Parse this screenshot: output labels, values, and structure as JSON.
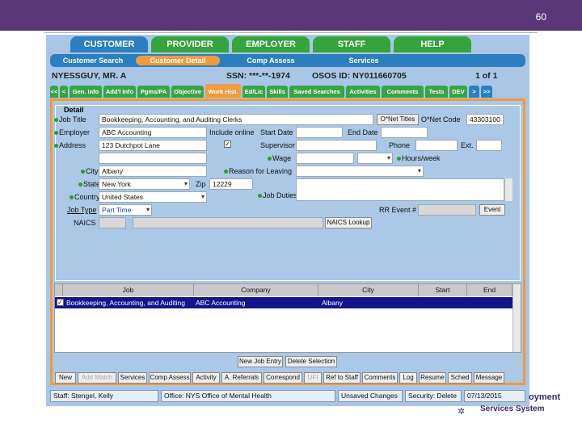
{
  "slide": {
    "number": "60"
  },
  "main_tabs": [
    {
      "label": "CUSTOMER",
      "active": true
    },
    {
      "label": "PROVIDER",
      "active": false
    },
    {
      "label": "EMPLOYER",
      "active": false
    },
    {
      "label": "STAFF",
      "active": false
    },
    {
      "label": "HELP",
      "active": false
    }
  ],
  "sub_nav": [
    "Customer Search",
    "Customer Detail",
    "Comp Assess",
    "Services"
  ],
  "case_line": {
    "name": "NYESSGUY, MR. A",
    "ssn": "SSN: ***-**-1974",
    "osos_id": "OSOS ID: NY011660705",
    "pager": "1 of 1"
  },
  "detail_tabs": [
    "<<",
    "<",
    "Gen. Info",
    "Add'l Info",
    "Pgms/PA",
    "Objective",
    "Work Hist.",
    "Ed/Lic",
    "Skills",
    "Saved Searches",
    "Activities",
    "Comments",
    "Tests",
    "DEV",
    ">",
    ">>"
  ],
  "detail": {
    "legend": "Detail",
    "job_title_label": "Job Title",
    "job_title_value": "Bookkeeping, Accounting, and Auditing Clerks",
    "onet_titles_btn": "O*Net Titles",
    "onet_code_label": "O*Net Code",
    "onet_code_value": "43303100",
    "employer_label": "Employer",
    "employer_value": "ABC Accounting",
    "include_online_label": "Include online",
    "start_date_label": "Start Date",
    "end_date_label": "End Date",
    "address_label": "Address",
    "address_value": "123 Dutchpot Lane",
    "supervisor_label": "Supervisor",
    "phone_label": "Phone",
    "ext_label": "Ext.",
    "wage_label": "Wage",
    "hours_week_label": "Hours/week",
    "city_label": "City",
    "city_value": "Albany",
    "reason_label": "Reason for Leaving",
    "state_label": "State",
    "state_value": "New York",
    "zip_label": "Zip",
    "zip_value": "12229",
    "country_label": "Country",
    "country_value": "United States",
    "job_duties_label": "Job Duties",
    "job_type_label": "Job Type",
    "job_type_value": "Part Time",
    "rr_event_label": "RR Event #",
    "event_btn": "Event",
    "naics_label": "NAICS",
    "naics_lookup_btn": "NAICS Lookup"
  },
  "grid": {
    "headers": [
      "Job",
      "Company",
      "City",
      "Start",
      "End"
    ],
    "rows": [
      {
        "job": "Bookkeeping, Accounting, and Auditing",
        "company": "ABC Accounting",
        "city": "Albany",
        "start": "",
        "end": ""
      }
    ],
    "new_job_btn": "New Job Entry",
    "delete_btn": "Delete Selection"
  },
  "toolbar": [
    "New",
    "Add Match",
    "Services",
    "Comp Assess",
    "Activity",
    "A. Referrals",
    "Correspond",
    "UFI",
    "Ref to Staff",
    "Comments",
    "Log",
    "Resume",
    "Sched",
    "Message"
  ],
  "status_bar": {
    "staff": "Staff: Stengel, Kelly",
    "office": "Office: NYS Office of Mental Health",
    "unsaved": "Unsaved Changes",
    "security": "Security: Delete",
    "date": "07/13/2015"
  },
  "logo": {
    "line1": "oyment",
    "line2": "Services System"
  }
}
